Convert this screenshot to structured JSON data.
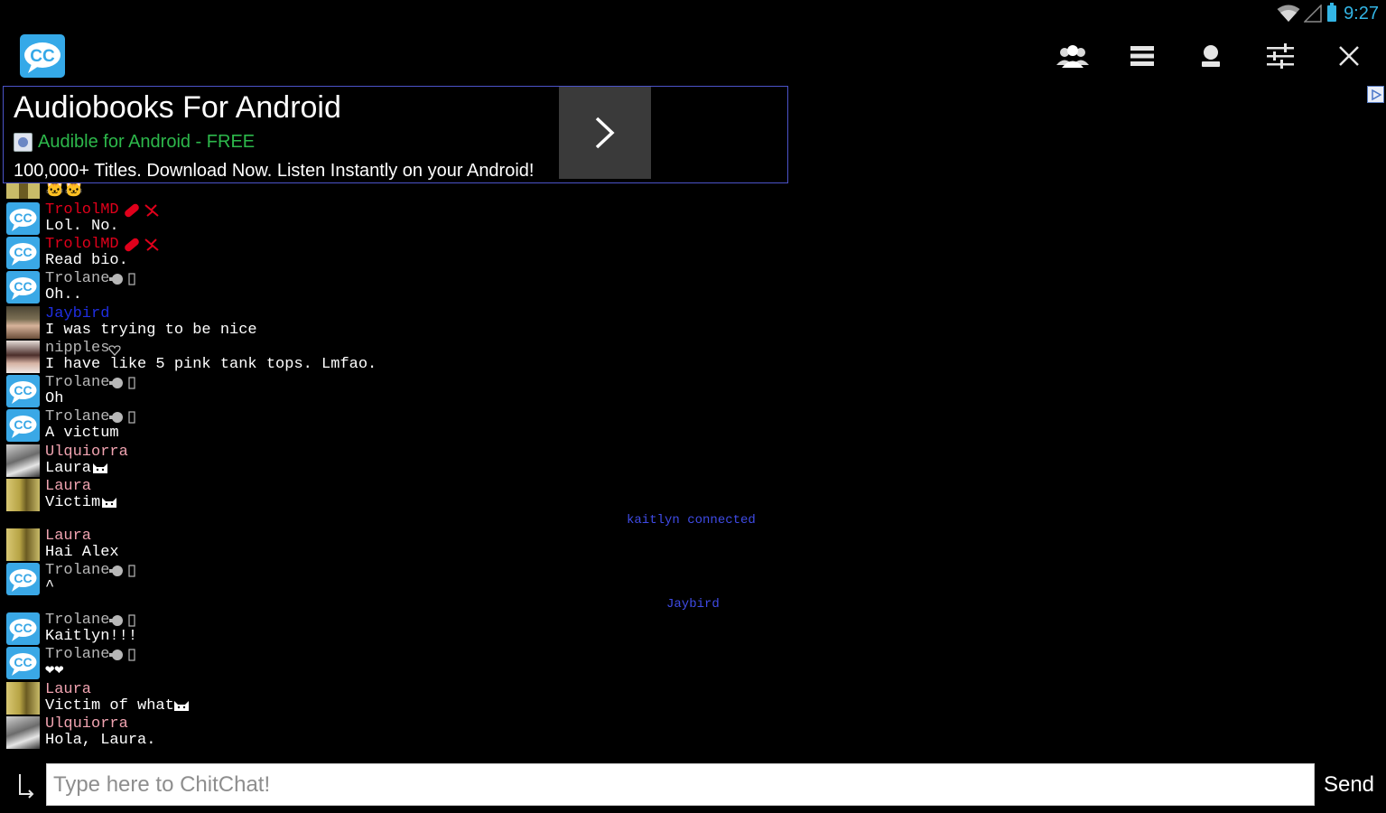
{
  "status_bar": {
    "time": "9:27"
  },
  "colors": {
    "accent_blue": "#33b5e5",
    "mod_red": "#e0001b",
    "user_gray": "#b7b7b7",
    "user_pink": "#f0a3b0",
    "user_blue": "#1f2ee0",
    "system_blue": "#3f4be6",
    "ad_border": "#4b53c8",
    "ad_green": "#2db84b"
  },
  "action_bar": {
    "logo": "chitchat-cc-logo-icon",
    "actions": [
      {
        "name": "users-action-icon"
      },
      {
        "name": "rooms-list-action-icon"
      },
      {
        "name": "profile-action-icon"
      },
      {
        "name": "settings-sliders-action-icon"
      },
      {
        "name": "close-action-icon"
      }
    ]
  },
  "ad": {
    "title": "Audiobooks For Android",
    "source": "Audible for Android - FREE",
    "description": "100,000+ Titles. Download Now. Listen Instantly on your Android!"
  },
  "chat": {
    "partial_top_text": "🐱🐱",
    "messages": [
      {
        "user": "TrololMD",
        "text": "Lol. No."
      },
      {
        "user": "TrololMD",
        "text": "Read bio."
      },
      {
        "user": "Trolane",
        "text": "Oh.."
      },
      {
        "user": "Jaybird",
        "text": "I was trying to be nice"
      },
      {
        "user": "nipples",
        "text": "I have like 5 pink tank tops. Lmfao."
      },
      {
        "user": "Trolane",
        "text": "Oh"
      },
      {
        "user": "Trolane",
        "text": "A victum"
      },
      {
        "user": "Ulquiorra",
        "text": "Laura"
      },
      {
        "user": "Laura",
        "text": "Victim"
      },
      {
        "user": "Laura",
        "text": "Hai Alex"
      },
      {
        "user": "Trolane",
        "text": "^"
      },
      {
        "user": "Trolane",
        "text": "Kaitlyn!!!"
      },
      {
        "user": "Trolane",
        "text": "❤❤"
      },
      {
        "user": "Laura",
        "text": "Victim of what"
      },
      {
        "user": "Ulquiorra",
        "text": "Hola, Laura."
      }
    ],
    "system_messages": [
      "kaitlyn connected",
      "Jaybird"
    ]
  },
  "input": {
    "placeholder": "Type here to ChitChat!",
    "send_label": "Send"
  }
}
